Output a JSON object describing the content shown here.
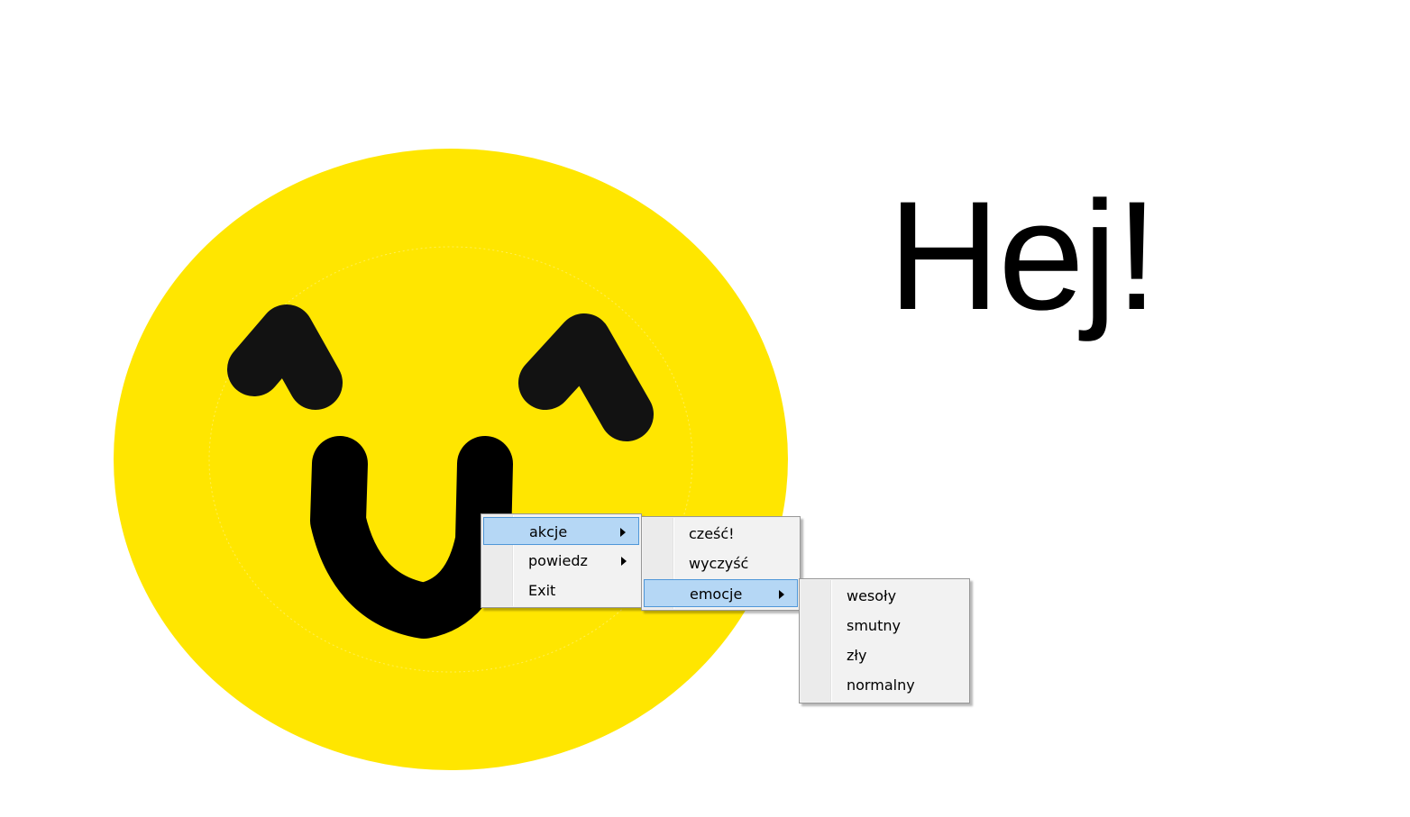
{
  "greeting": "Hej!",
  "colors": {
    "face": "#ffe600",
    "features": "#121212",
    "menu_background": "#f2f2f2",
    "menu_highlight": "#b5d7f5",
    "menu_highlight_border": "#4f97d8"
  },
  "context_menu": {
    "items": [
      {
        "label": "akcje",
        "has_submenu": true,
        "highlighted": true
      },
      {
        "label": "powiedz",
        "has_submenu": true,
        "highlighted": false
      },
      {
        "label": "Exit",
        "has_submenu": false,
        "highlighted": false
      }
    ]
  },
  "akcje_submenu": {
    "items": [
      {
        "label": "cześć!",
        "has_submenu": false,
        "highlighted": false
      },
      {
        "label": "wyczyść",
        "has_submenu": false,
        "highlighted": false
      },
      {
        "label": "emocje",
        "has_submenu": true,
        "highlighted": true
      }
    ]
  },
  "emocje_submenu": {
    "items": [
      {
        "label": "wesoły",
        "has_submenu": false,
        "highlighted": false
      },
      {
        "label": "smutny",
        "has_submenu": false,
        "highlighted": false
      },
      {
        "label": "zły",
        "has_submenu": false,
        "highlighted": false
      },
      {
        "label": "normalny",
        "has_submenu": false,
        "highlighted": false
      }
    ]
  }
}
